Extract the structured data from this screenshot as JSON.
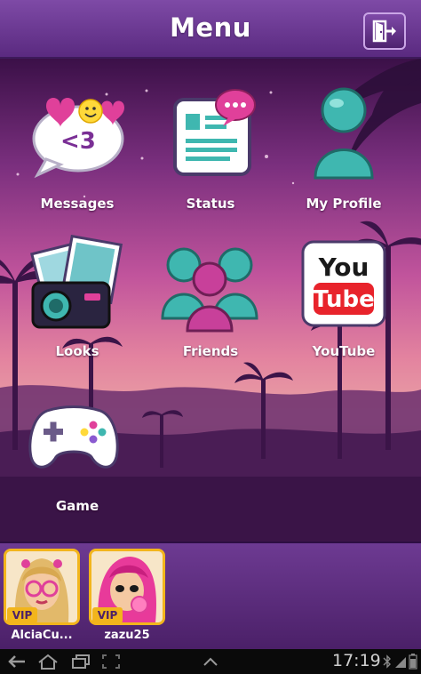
{
  "header": {
    "title": "Menu",
    "exit_icon": "exit-door-icon"
  },
  "menu": [
    {
      "id": "messages",
      "label": "Messages",
      "icon": "messages-bubble-icon",
      "icon_text": "<3"
    },
    {
      "id": "status",
      "label": "Status",
      "icon": "status-document-icon"
    },
    {
      "id": "my-profile",
      "label": "My Profile",
      "icon": "profile-person-icon"
    },
    {
      "id": "looks",
      "label": "Looks",
      "icon": "camera-photos-icon"
    },
    {
      "id": "friends",
      "label": "Friends",
      "icon": "friends-group-icon"
    },
    {
      "id": "youtube",
      "label": "YouTube",
      "icon": "youtube-icon",
      "icon_text_top": "You",
      "icon_text_bottom": "Tube"
    },
    {
      "id": "game",
      "label": "Game",
      "icon": "gamepad-icon"
    }
  ],
  "friends": [
    {
      "name": "AlciaCu...",
      "badge": "VIP"
    },
    {
      "name": "zazu25",
      "badge": "VIP"
    }
  ],
  "system": {
    "time": "17:19"
  },
  "colors": {
    "accent_purple": "#5a2a80",
    "vip_gold": "#f2b51c",
    "teal": "#3fb7b0",
    "pink": "#e0409a"
  }
}
